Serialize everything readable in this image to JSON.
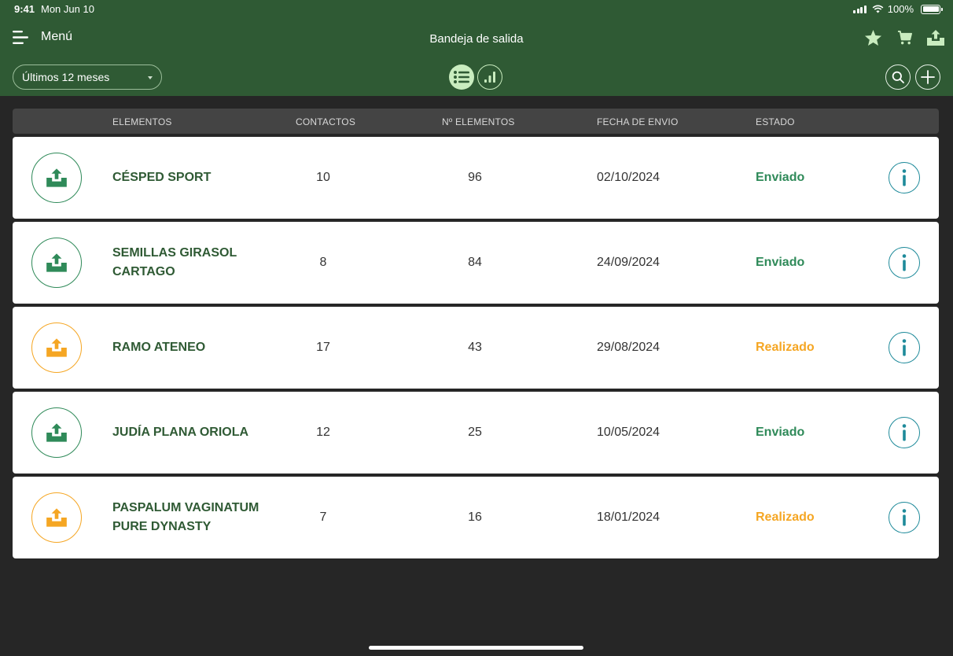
{
  "status_bar": {
    "time": "9:41",
    "date": "Mon Jun 10",
    "battery": "100%"
  },
  "header": {
    "menu_label": "Menú",
    "title": "Bandeja de salida",
    "actions": [
      "star-icon",
      "cart-icon",
      "outbox-icon"
    ]
  },
  "filters": {
    "period": "Últimos 12 meses",
    "views": [
      "list-view",
      "chart-view"
    ],
    "active_view": "list-view"
  },
  "table": {
    "headers": {
      "name": "ELEMENTOS",
      "contacts": "CONTACTOS",
      "items": "Nº ELEMENTOS",
      "date": "FECHA DE ENVIO",
      "status": "ESTADO"
    },
    "rows": [
      {
        "name": "CÉSPED SPORT",
        "contacts": "10",
        "items": "96",
        "date": "02/10/2024",
        "status": "Enviado",
        "state": "sent"
      },
      {
        "name": "SEMILLAS  GIRASOL CARTAGO",
        "contacts": "8",
        "items": "84",
        "date": "24/09/2024",
        "status": "Enviado",
        "state": "sent"
      },
      {
        "name": "RAMO ATENEO",
        "contacts": "17",
        "items": "43",
        "date": "29/08/2024",
        "status": "Realizado",
        "state": "done"
      },
      {
        "name": "JUDÍA PLANA ORIOLA",
        "contacts": "12",
        "items": "25",
        "date": "10/05/2024",
        "status": "Enviado",
        "state": "sent"
      },
      {
        "name": "PASPALUM VAGINATUM PURE DYNASTY",
        "contacts": "7",
        "items": "16",
        "date": "18/01/2024",
        "status": "Realizado",
        "state": "done"
      }
    ]
  },
  "colors": {
    "header_bg": "#2f5a34",
    "page_bg": "#262626",
    "sent": "#2f8a59",
    "done": "#f5a623",
    "info": "#1e8a9a",
    "accent_light": "#c9ecbf"
  }
}
